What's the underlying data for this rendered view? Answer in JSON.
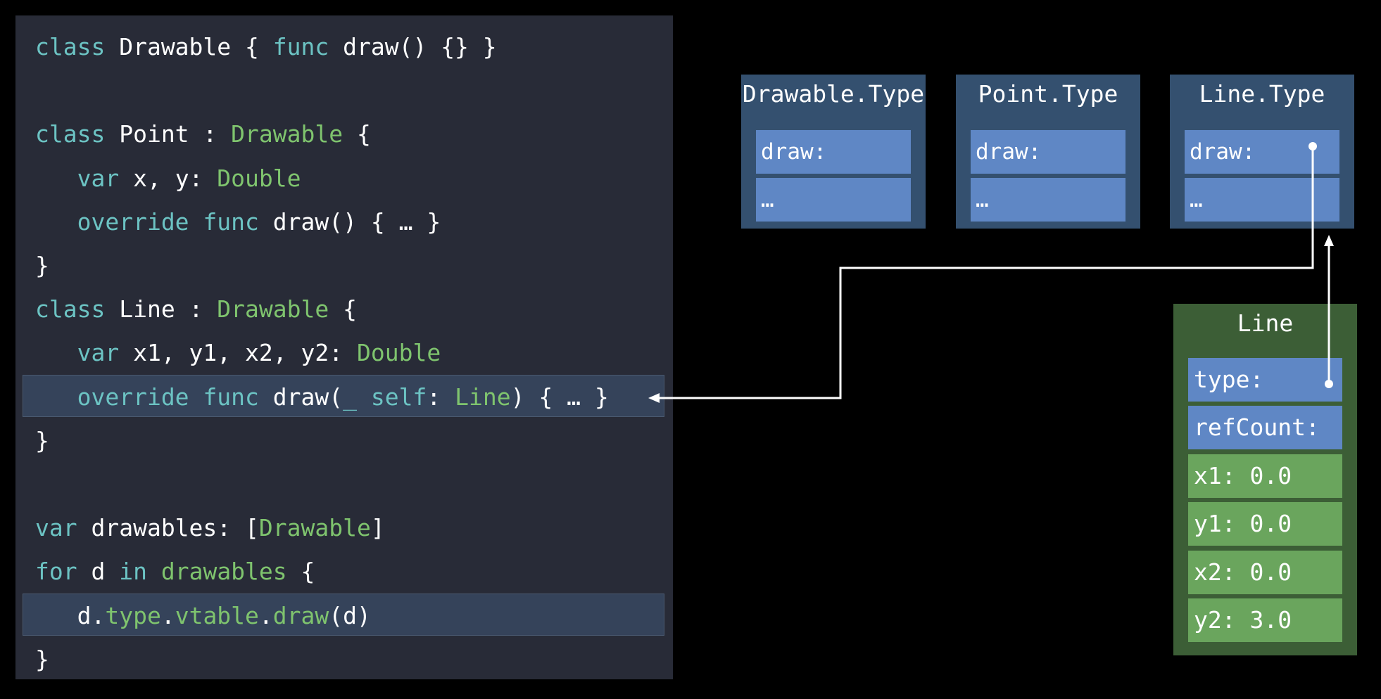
{
  "code": {
    "lines": [
      [
        {
          "t": "class",
          "c": "kw"
        },
        {
          "t": " Drawable { ",
          "c": "pl"
        },
        {
          "t": "func",
          "c": "kw"
        },
        {
          "t": " draw() {} }",
          "c": "pl"
        }
      ],
      [],
      [
        {
          "t": "class",
          "c": "kw"
        },
        {
          "t": " Point : ",
          "c": "pl"
        },
        {
          "t": "Drawable",
          "c": "ty"
        },
        {
          "t": " {",
          "c": "pl"
        }
      ],
      [
        {
          "t": "   ",
          "c": "pl"
        },
        {
          "t": "var",
          "c": "kw"
        },
        {
          "t": " x, y: ",
          "c": "pl"
        },
        {
          "t": "Double",
          "c": "ty"
        }
      ],
      [
        {
          "t": "   ",
          "c": "pl"
        },
        {
          "t": "override",
          "c": "kw"
        },
        {
          "t": " ",
          "c": "pl"
        },
        {
          "t": "func",
          "c": "kw"
        },
        {
          "t": " draw() { … }",
          "c": "pl"
        }
      ],
      [
        {
          "t": "}",
          "c": "pl"
        }
      ],
      [
        {
          "t": "class",
          "c": "kw"
        },
        {
          "t": " Line : ",
          "c": "pl"
        },
        {
          "t": "Drawable",
          "c": "ty"
        },
        {
          "t": " {",
          "c": "pl"
        }
      ],
      [
        {
          "t": "   ",
          "c": "pl"
        },
        {
          "t": "var",
          "c": "kw"
        },
        {
          "t": " x1, y1, x2, y2: ",
          "c": "pl"
        },
        {
          "t": "Double",
          "c": "ty"
        }
      ],
      [
        {
          "t": "   ",
          "c": "pl"
        },
        {
          "t": "override",
          "c": "kw"
        },
        {
          "t": " ",
          "c": "pl"
        },
        {
          "t": "func",
          "c": "kw"
        },
        {
          "t": " draw(",
          "c": "pl"
        },
        {
          "t": "_",
          "c": "kw"
        },
        {
          "t": " ",
          "c": "pl"
        },
        {
          "t": "self",
          "c": "kw"
        },
        {
          "t": ": ",
          "c": "pl"
        },
        {
          "t": "Line",
          "c": "ty"
        },
        {
          "t": ") { … }",
          "c": "pl"
        }
      ],
      [
        {
          "t": "}",
          "c": "pl"
        }
      ],
      [],
      [
        {
          "t": "var",
          "c": "kw"
        },
        {
          "t": " drawables: [",
          "c": "pl"
        },
        {
          "t": "Drawable",
          "c": "ty"
        },
        {
          "t": "]",
          "c": "pl"
        }
      ],
      [
        {
          "t": "for",
          "c": "kw"
        },
        {
          "t": " d ",
          "c": "pl"
        },
        {
          "t": "in",
          "c": "kw"
        },
        {
          "t": " ",
          "c": "pl"
        },
        {
          "t": "drawables",
          "c": "ty"
        },
        {
          "t": " {",
          "c": "pl"
        }
      ],
      [
        {
          "t": "   d.",
          "c": "pl"
        },
        {
          "t": "type",
          "c": "ty"
        },
        {
          "t": ".",
          "c": "pl"
        },
        {
          "t": "vtable",
          "c": "ty"
        },
        {
          "t": ".",
          "c": "pl"
        },
        {
          "t": "draw",
          "c": "ty"
        },
        {
          "t": "(d)",
          "c": "pl"
        }
      ],
      [
        {
          "t": "}",
          "c": "pl"
        }
      ]
    ],
    "highlighted_lines": [
      8,
      13
    ]
  },
  "type_boxes": [
    {
      "title": "Drawable.Type",
      "slots": [
        "draw:",
        "…"
      ]
    },
    {
      "title": "Point.Type",
      "slots": [
        "draw:",
        "…"
      ]
    },
    {
      "title": "Line.Type",
      "slots": [
        "draw:",
        "…"
      ]
    }
  ],
  "instance": {
    "title": "Line",
    "fields": [
      {
        "label": "type:",
        "color": "blue"
      },
      {
        "label": "refCount:",
        "color": "blue"
      },
      {
        "label": "x1: 0.0",
        "color": "green"
      },
      {
        "label": "y1: 0.0",
        "color": "green"
      },
      {
        "label": "x2: 0.0",
        "color": "green"
      },
      {
        "label": "y2: 3.0",
        "color": "green"
      }
    ]
  },
  "colors": {
    "background": "#000000",
    "code_panel": "#282b37",
    "keyword": "#6cc3c3",
    "type": "#7fc46e",
    "type_box": "#34506f",
    "slot": "#5f87c5",
    "instance_box": "#3c5e36",
    "field_green": "#6aa55d"
  }
}
